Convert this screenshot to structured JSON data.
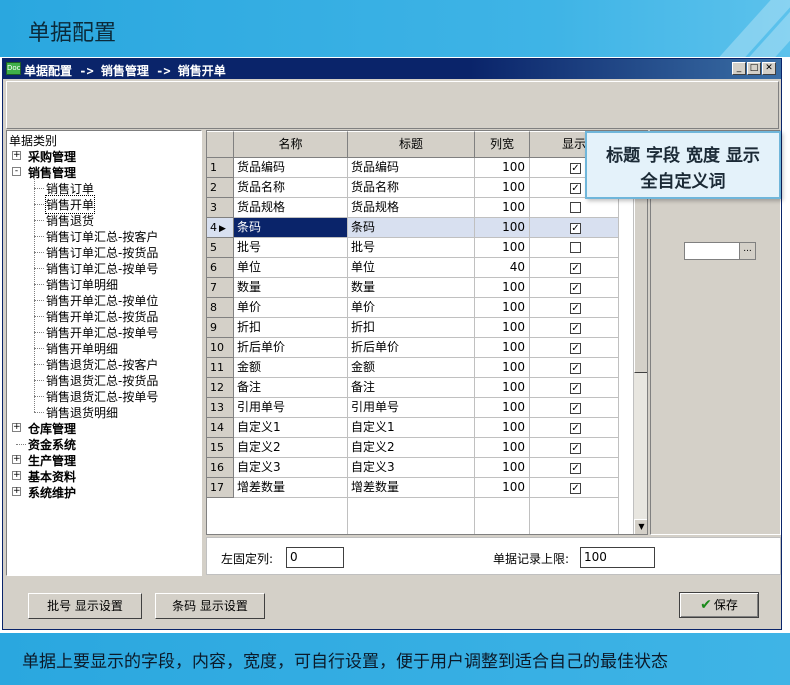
{
  "banner": {
    "title": "单据配置"
  },
  "window": {
    "title": "单据配置 -> 销售管理 -> 销售开单",
    "icon_text": "Doc"
  },
  "tree": {
    "root": "单据类别",
    "groups": [
      {
        "label": "采购管理",
        "expander": "+"
      },
      {
        "label": "销售管理",
        "expander": "-"
      },
      {
        "label": "仓库管理",
        "expander": "+"
      },
      {
        "label": "资金系统",
        "expander": ""
      },
      {
        "label": "生产管理",
        "expander": "+"
      },
      {
        "label": "基本资料",
        "expander": "+"
      },
      {
        "label": "系统维护",
        "expander": "+"
      }
    ],
    "sales_children": [
      "销售订单",
      "销售开单",
      "销售退货",
      "销售订单汇总-按客户",
      "销售订单汇总-按货品",
      "销售订单汇总-按单号",
      "销售订单明细",
      "销售开单汇总-按单位",
      "销售开单汇总-按货品",
      "销售开单汇总-按单号",
      "销售开单明细",
      "销售退货汇总-按客户",
      "销售退货汇总-按货品",
      "销售退货汇总-按单号",
      "销售退货明细"
    ],
    "selected": "销售开单"
  },
  "grid": {
    "columns": [
      "名称",
      "标题",
      "列宽",
      "显示"
    ],
    "rows": [
      {
        "no": "1",
        "name": "货品编码",
        "title": "货品编码",
        "width": "100",
        "show": true
      },
      {
        "no": "2",
        "name": "货品名称",
        "title": "货品名称",
        "width": "100",
        "show": true
      },
      {
        "no": "3",
        "name": "货品规格",
        "title": "货品规格",
        "width": "100",
        "show": false
      },
      {
        "no": "4",
        "name": "条码",
        "title": "条码",
        "width": "100",
        "show": true
      },
      {
        "no": "5",
        "name": "批号",
        "title": "批号",
        "width": "100",
        "show": false
      },
      {
        "no": "6",
        "name": "单位",
        "title": "单位",
        "width": "40",
        "show": true
      },
      {
        "no": "7",
        "name": "数量",
        "title": "数量",
        "width": "100",
        "show": true
      },
      {
        "no": "8",
        "name": "单价",
        "title": "单价",
        "width": "100",
        "show": true
      },
      {
        "no": "9",
        "name": "折扣",
        "title": "折扣",
        "width": "100",
        "show": true
      },
      {
        "no": "10",
        "name": "折后单价",
        "title": "折后单价",
        "width": "100",
        "show": true
      },
      {
        "no": "11",
        "name": "金额",
        "title": "金额",
        "width": "100",
        "show": true
      },
      {
        "no": "12",
        "name": "备注",
        "title": "备注",
        "width": "100",
        "show": true
      },
      {
        "no": "13",
        "name": "引用单号",
        "title": "引用单号",
        "width": "100",
        "show": true
      },
      {
        "no": "14",
        "name": "自定义1",
        "title": "自定义1",
        "width": "100",
        "show": true
      },
      {
        "no": "15",
        "name": "自定义2",
        "title": "自定义2",
        "width": "100",
        "show": true
      },
      {
        "no": "16",
        "name": "自定义3",
        "title": "自定义3",
        "width": "100",
        "show": true
      },
      {
        "no": "17",
        "name": "增差数量",
        "title": "增差数量",
        "width": "100",
        "show": true
      }
    ],
    "selected_row": "4",
    "row_pointer": "▶",
    "check_mark": "✓"
  },
  "tooltip": {
    "line1": "标题 字段 宽度 显示",
    "line2": "全自定义词"
  },
  "settings": {
    "fixed_cols_label": "左固定列:",
    "fixed_cols_value": "0",
    "max_records_label": "单据记录上限:",
    "max_records_value": "100"
  },
  "buttons": {
    "batch": "批号 显示设置",
    "barcode": "条码 显示设置",
    "save": "保存",
    "save_icon": "✔"
  },
  "ellipsis": "...",
  "caption": "单据上要显示的字段，内容，宽度，可自行设置，便于用户调整到适合自己的最佳状态",
  "window_buttons": {
    "minimize": "_",
    "maximize": "□",
    "close": "✕"
  }
}
